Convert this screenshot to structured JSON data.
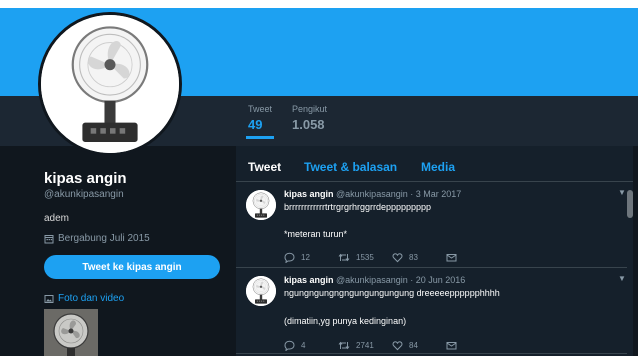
{
  "profile": {
    "name": "kipas angin",
    "handle": "@akunkipasangin",
    "bio": "adem",
    "joined": "Bergabung Juli 2015",
    "tweet_to_label": "Tweet ke kipas angin",
    "photos_label": "Foto dan video"
  },
  "stats": {
    "tweets_label": "Tweet",
    "tweets_value": "49",
    "followers_label": "Pengikut",
    "followers_value": "1.058"
  },
  "tabs": [
    "Tweet",
    "Tweet & balasan",
    "Media"
  ],
  "tweets": [
    {
      "name": "kipas angin",
      "handle": "@akunkipasangin",
      "date": "3 Mar 2017",
      "line1": "brrrrrrrrrrrrtrtrgrgrhrggrrdeppppppppp",
      "line2": "*meteran turun*",
      "replies": "12",
      "retweets": "1535",
      "likes": "83"
    },
    {
      "name": "kipas angin",
      "handle": "@akunkipasangin",
      "date": "20 Jun 2016",
      "line1": "ngungngungngngungungungung dreeeeepppppphhhh",
      "line2": "(dimatiin,yg punya kedinginan)",
      "replies": "4",
      "retweets": "2741",
      "likes": "84"
    }
  ],
  "colors": {
    "accent": "#1da1f2",
    "background": "#10171e",
    "panel": "#15202b",
    "stats_bar": "#1c2733"
  },
  "icons": {
    "header_caret": "chevron-down-icon",
    "reply": "reply-icon",
    "retweet": "retweet-icon",
    "like": "heart-icon",
    "dm": "message-icon",
    "joined": "calendar-icon",
    "photos": "image-icon"
  }
}
